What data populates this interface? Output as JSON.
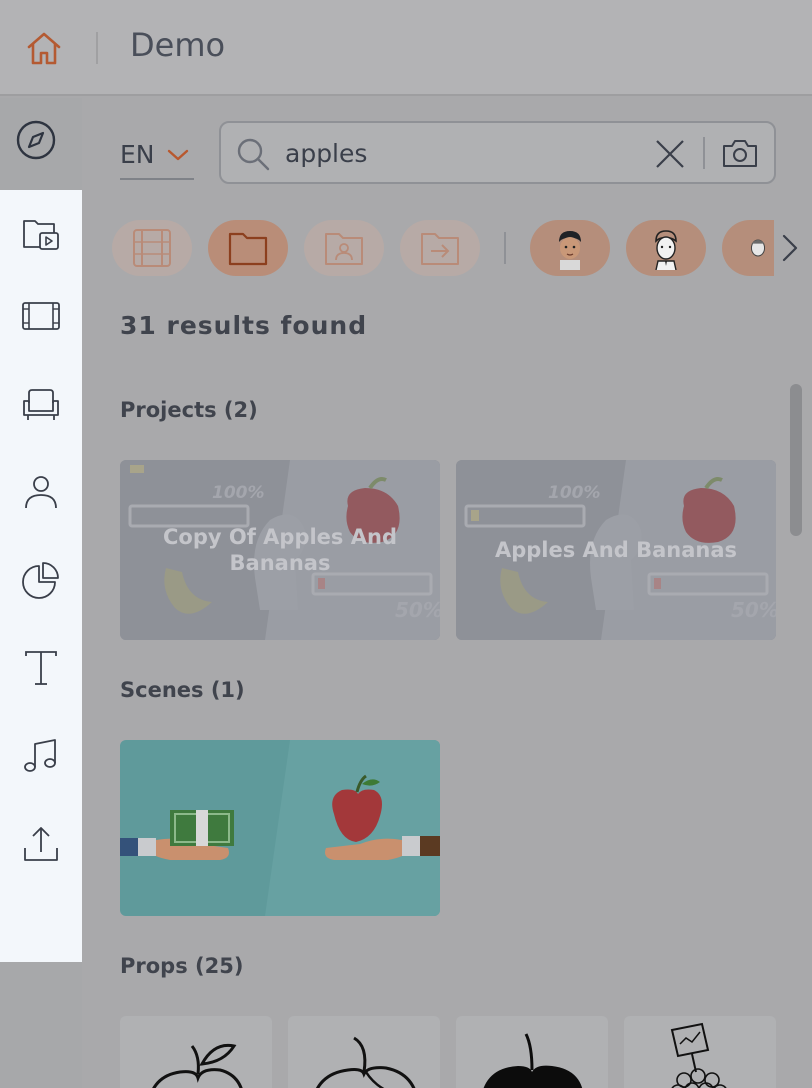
{
  "header": {
    "title": "Demo",
    "home_icon": "home-icon"
  },
  "rail": {
    "top_icon": "compass-icon",
    "items": [
      {
        "name": "project-library",
        "icon": "folder-play-icon"
      },
      {
        "name": "scenes",
        "icon": "film-icon"
      },
      {
        "name": "props",
        "icon": "armchair-icon"
      },
      {
        "name": "characters",
        "icon": "person-icon"
      },
      {
        "name": "charts",
        "icon": "pie-chart-icon"
      },
      {
        "name": "text",
        "icon": "text-icon"
      },
      {
        "name": "audio",
        "icon": "music-note-icon"
      },
      {
        "name": "upload",
        "icon": "upload-icon"
      }
    ]
  },
  "search": {
    "language": "EN",
    "query": "apples",
    "placeholder": "Search"
  },
  "filters": {
    "chips": [
      {
        "name": "scenes-filter",
        "icon": "film-icon",
        "active": false
      },
      {
        "name": "projects-filter",
        "icon": "folder-icon",
        "active": true
      },
      {
        "name": "user-folder-filter",
        "icon": "folder-user-icon",
        "active": false
      },
      {
        "name": "shared-folder-filter",
        "icon": "folder-arrow-icon",
        "active": false
      },
      {
        "name": "avatar-1",
        "icon": "avatar-icon",
        "active": false
      },
      {
        "name": "avatar-2",
        "icon": "avatar-icon",
        "active": false
      },
      {
        "name": "avatar-3",
        "icon": "avatar-icon",
        "active": false
      }
    ]
  },
  "results_text": "31 results found",
  "sections": {
    "projects": {
      "title": "Projects (2)",
      "items": [
        {
          "title": "Copy Of Apples And Bananas"
        },
        {
          "title": "Apples And Bananas"
        }
      ],
      "thumb_labels": {
        "top": "100%",
        "bottom": "50%"
      }
    },
    "scenes": {
      "title": "Scenes (1)"
    },
    "props": {
      "title": "Props (25)"
    }
  },
  "colors": {
    "accent": "#b8582e",
    "panel": "#f3f7fb",
    "overlay": "#a9a9ab"
  }
}
